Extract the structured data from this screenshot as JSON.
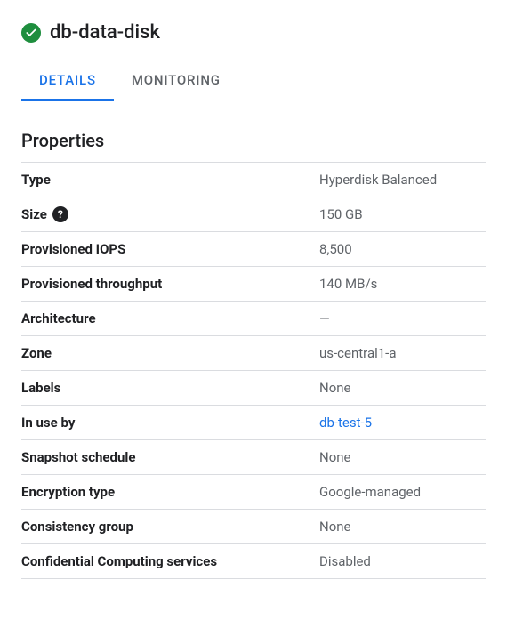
{
  "header": {
    "title": "db-data-disk",
    "status": "healthy"
  },
  "tabs": [
    {
      "label": "DETAILS",
      "active": true
    },
    {
      "label": "MONITORING",
      "active": false
    }
  ],
  "section_title": "Properties",
  "properties": [
    {
      "label": "Type",
      "value": "Hyperdisk Balanced",
      "help": false,
      "link": false
    },
    {
      "label": "Size",
      "value": "150 GB",
      "help": true,
      "link": false
    },
    {
      "label": "Provisioned IOPS",
      "value": "8,500",
      "help": false,
      "link": false
    },
    {
      "label": "Provisioned throughput",
      "value": "140 MB/s",
      "help": false,
      "link": false
    },
    {
      "label": "Architecture",
      "value": "—",
      "help": false,
      "link": false
    },
    {
      "label": "Zone",
      "value": "us-central1-a",
      "help": false,
      "link": false
    },
    {
      "label": "Labels",
      "value": "None",
      "help": false,
      "link": false
    },
    {
      "label": "In use by",
      "value": "db-test-5",
      "help": false,
      "link": true
    },
    {
      "label": "Snapshot schedule",
      "value": "None",
      "help": false,
      "link": false
    },
    {
      "label": "Encryption type",
      "value": "Google-managed",
      "help": false,
      "link": false
    },
    {
      "label": "Consistency group",
      "value": "None",
      "help": false,
      "link": false
    },
    {
      "label": "Confidential Computing services",
      "value": "Disabled",
      "help": false,
      "link": false
    }
  ]
}
